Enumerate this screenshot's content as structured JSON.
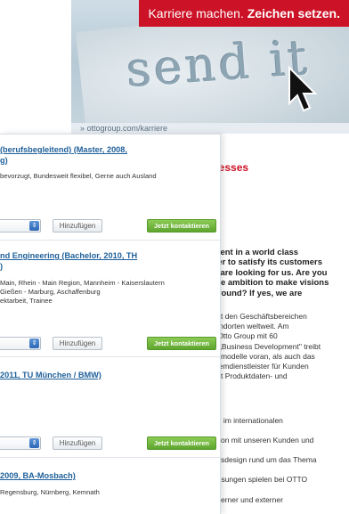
{
  "banner": {
    "career_text_normal": "Karriere machen.",
    "career_text_bold": "Zeichen setzen.",
    "screen_text": "send it",
    "url": "» ottogroup.com/karriere",
    "accent_color": "#cc1226"
  },
  "article": {
    "heading": "cesses",
    "bold_lines": [
      "ment in a world class",
      "ver to satisfy its customers",
      "u are looking for us. Are you",
      "the ambition to make visions",
      "ground? If yes, we are"
    ],
    "para1": [
      "mit den Geschäftsbereichen",
      "tandorten weltweit. Am",
      "r Otto Group mit 60",
      "n „Business Development\" treibt",
      "ftsmodelle voran, als auch das",
      "stemdienstleister für Kunden",
      "nkt Produktdaten- und"
    ],
    "line_a": "ng im internationalen",
    "line_b": "ation mit unseren Kunden und",
    "line_c": "essdesign rund um das Thema",
    "line_d": "Lösungen spielen bei OTTO",
    "line_e": "interner und externer"
  },
  "jobs": [
    {
      "title_lines": [
        "(berufsbegleitend) (Master, 2008,",
        "g)"
      ],
      "meta_lines": [
        "bevorzugt, Bundesweit flexibel, Gerne auch Ausland"
      ]
    },
    {
      "title_lines": [
        "nd Engineering (Bachelor, 2010, TH",
        ")"
      ],
      "meta_lines": [
        "Main, Rhein - Main Region, Mannheim - Kaiserslautern",
        "Gießen - Marburg, Aschaffenburg",
        "ektarbeit, Trainee"
      ]
    },
    {
      "title_lines": [
        "2011, TU München / BMW)"
      ],
      "meta_lines": []
    },
    {
      "title_lines": [
        "2009, BA-Mosbach)"
      ],
      "meta_lines": [
        "Regensburg, Nürnberg, Kemnath"
      ]
    }
  ],
  "actions": {
    "add_label": "Hinzufügen",
    "contact_label": "Jetzt kontaktieren",
    "select_arrow": "⇕"
  }
}
